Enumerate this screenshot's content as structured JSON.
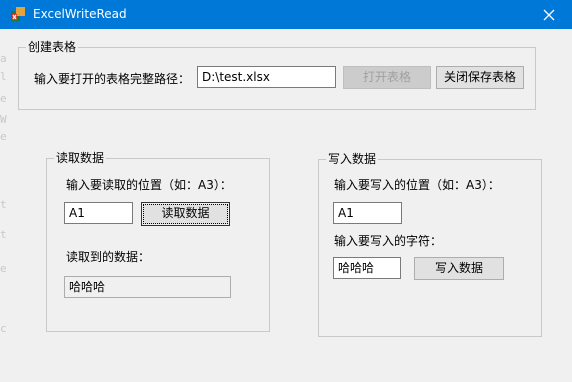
{
  "window": {
    "title": "ExcelWriteRead",
    "icon": "excel-app-icon",
    "close_icon": "close-icon"
  },
  "background_console_glyphs": [
    "a",
    "l",
    "e",
    "W",
    "e",
    "t",
    "t",
    "e",
    "c"
  ],
  "create_table": {
    "group_title": "创建表格",
    "path_label": "输入要打开的表格完整路径：",
    "path_value": "D:\\test.xlsx",
    "open_button": "打开表格",
    "close_save_button": "关闭保存表格"
  },
  "read_data": {
    "group_title": "读取数据",
    "position_label": "输入要读取的位置（如：A3）：",
    "position_value": "A1",
    "read_button": "读取数据",
    "result_label": "读取到的数据：",
    "result_value": "哈哈哈"
  },
  "write_data": {
    "group_title": "写入数据",
    "position_label": "输入要写入的位置（如：A3）：",
    "position_value": "A1",
    "text_label": "输入要写入的字符：",
    "text_value": "哈哈哈",
    "write_button": "写入数据"
  }
}
